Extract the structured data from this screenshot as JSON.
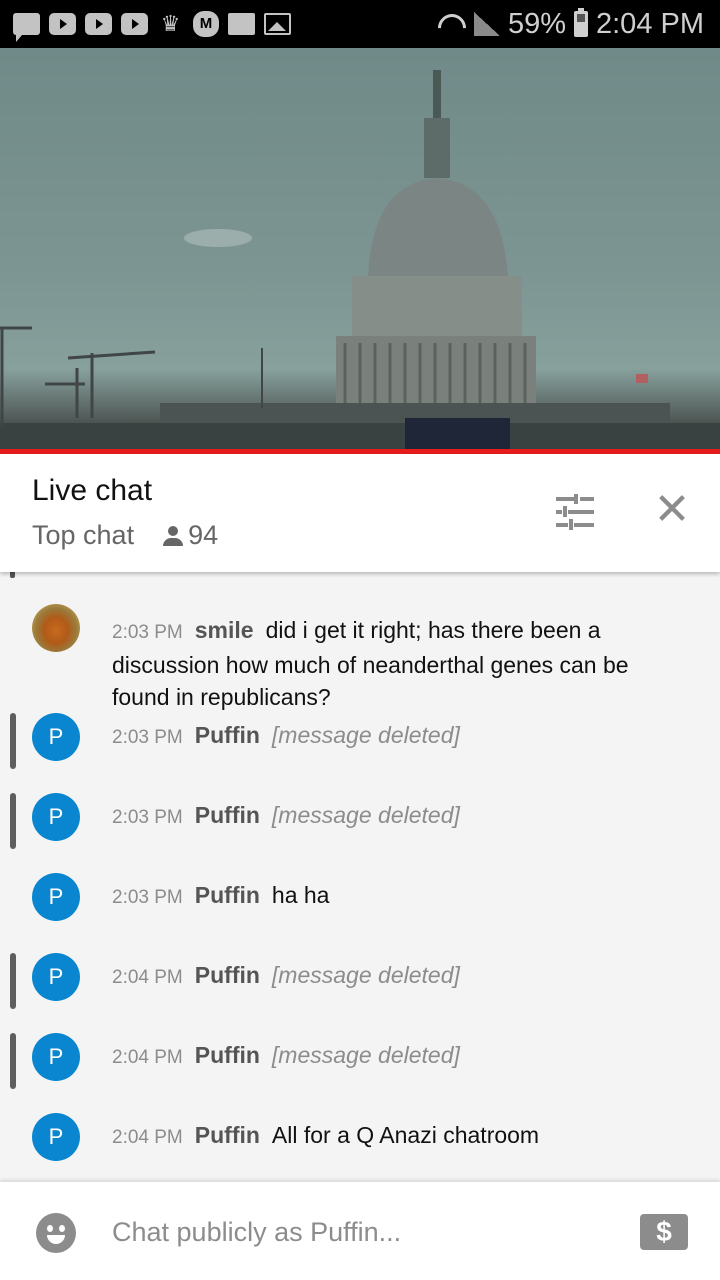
{
  "status_bar": {
    "notification_icons": [
      "chat-bubble-icon",
      "youtube-icon",
      "youtube-icon",
      "youtube-icon",
      "crown-icon",
      "m-app-icon",
      "folder-icon",
      "image-icon"
    ],
    "battery": "59%",
    "time": "2:04 PM"
  },
  "video": {
    "description": "Live stream of the U.S. Capitol dome",
    "progress_color": "#e61c1c"
  },
  "chat_header": {
    "title": "Live chat",
    "mode": "Top chat",
    "viewer_count": "94"
  },
  "messages": [
    {
      "avatar": "",
      "avatar_type": "image",
      "time": "2:03 PM",
      "author": "smile",
      "text": "did i get it right; has there been a discussion how much of neanderthal genes can be found in republicans?",
      "deleted": false,
      "flagged": false
    },
    {
      "avatar": "P",
      "avatar_type": "letter",
      "time": "2:03 PM",
      "author": "Puffin",
      "text": "[message deleted]",
      "deleted": true,
      "flagged": true
    },
    {
      "avatar": "P",
      "avatar_type": "letter",
      "time": "2:03 PM",
      "author": "Puffin",
      "text": "[message deleted]",
      "deleted": true,
      "flagged": true
    },
    {
      "avatar": "P",
      "avatar_type": "letter",
      "time": "2:03 PM",
      "author": "Puffin",
      "text": "ha ha",
      "deleted": false,
      "flagged": false
    },
    {
      "avatar": "P",
      "avatar_type": "letter",
      "time": "2:04 PM",
      "author": "Puffin",
      "text": "[message deleted]",
      "deleted": true,
      "flagged": true
    },
    {
      "avatar": "P",
      "avatar_type": "letter",
      "time": "2:04 PM",
      "author": "Puffin",
      "text": "[message deleted]",
      "deleted": true,
      "flagged": true
    },
    {
      "avatar": "P",
      "avatar_type": "letter",
      "time": "2:04 PM",
      "author": "Puffin",
      "text": "All for a Q Anazi chatroom",
      "deleted": false,
      "flagged": false
    }
  ],
  "input": {
    "placeholder": "Chat publicly as Puffin...",
    "value": "",
    "superchat_label": "$"
  },
  "colors": {
    "avatar_blue": "#0a86d0",
    "icon_gray": "#8c8c8c",
    "accent_red": "#e61c1c"
  }
}
